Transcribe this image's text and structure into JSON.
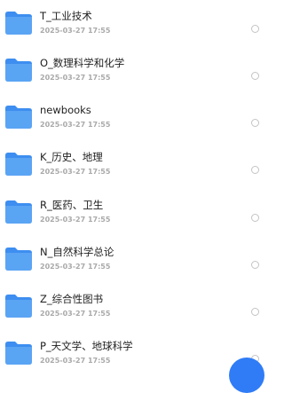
{
  "folders": [
    {
      "name": "T_工业技术",
      "date": "2025-03-27 17:55"
    },
    {
      "name": "O_数理科学和化学",
      "date": "2025-03-27 17:55"
    },
    {
      "name": "newbooks",
      "date": "2025-03-27 17:55"
    },
    {
      "name": "K_历史、地理",
      "date": "2025-03-27 17:55"
    },
    {
      "name": "R_医药、卫生",
      "date": "2025-03-27 17:55"
    },
    {
      "name": "N_自然科学总论",
      "date": "2025-03-27 17:55"
    },
    {
      "name": "Z_综合性图书",
      "date": "2025-03-27 17:55"
    },
    {
      "name": "P_天文学、地球科学",
      "date": "2025-03-27 17:55"
    }
  ],
  "icons": {
    "folder": "folder-icon",
    "select": "radio-unchecked-icon",
    "fab": "floating-action-button"
  },
  "colors": {
    "folder_body": "#5aa4f4",
    "folder_tab": "#3d8ef0",
    "name_text": "#1f1f1f",
    "date_text": "#a9a9a9",
    "fab": "#2f7cf6"
  }
}
